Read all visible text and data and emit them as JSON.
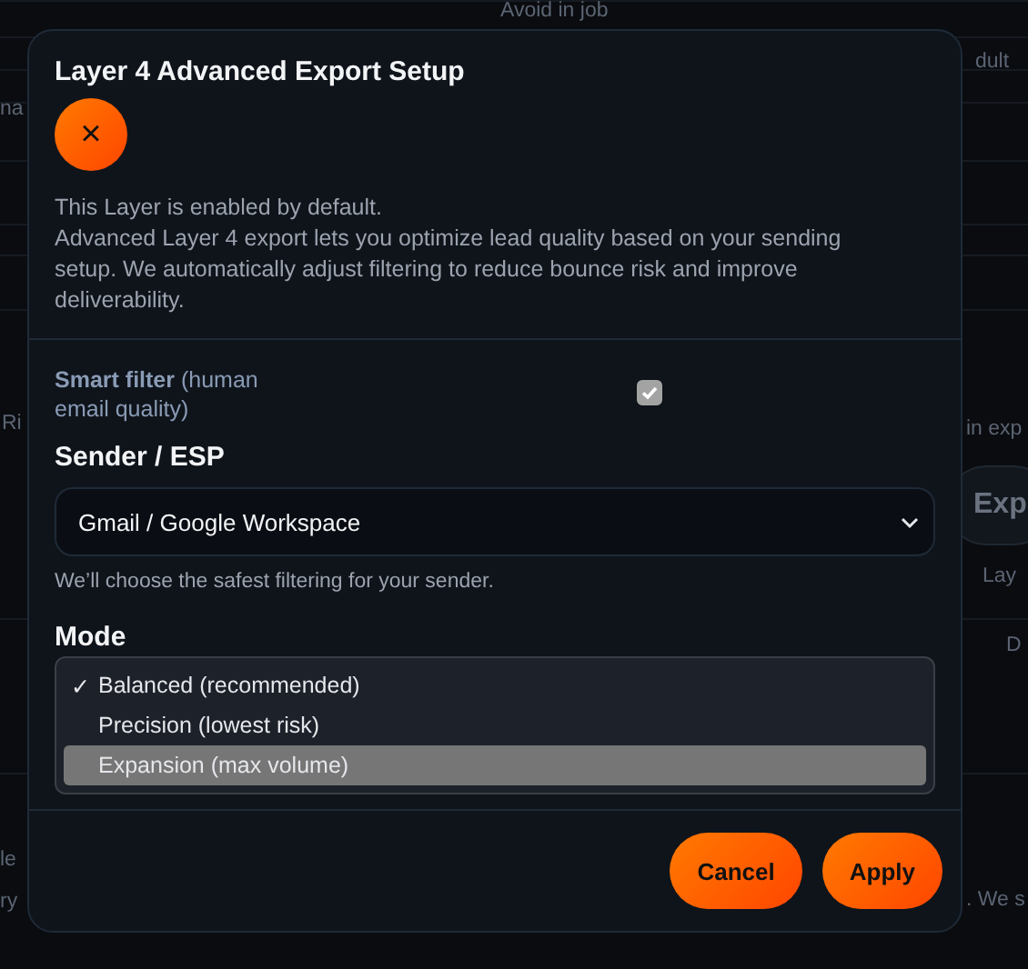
{
  "background": {
    "fragments": [
      {
        "text": "Avoid in job"
      },
      {
        "text": "dult"
      },
      {
        "text": "na"
      },
      {
        "text": "Ri"
      },
      {
        "text": "in exp"
      },
      {
        "text": "Exp",
        "kind": "button"
      },
      {
        "text": "Lay"
      },
      {
        "text": "D"
      },
      {
        "text": "le"
      },
      {
        "text": "ry"
      },
      {
        "text": ". We s"
      }
    ]
  },
  "dialog": {
    "title": "Layer 4 Advanced Export Setup",
    "close_button": {
      "label": "×"
    },
    "description": [
      "This Layer is enabled by default.",
      "Advanced Layer 4 export lets you optimize lead quality based on your sending setup. We automatically adjust filtering to reduce bounce risk and improve deliverability."
    ],
    "smart_filter": {
      "label": "**Smart filter** (human email quality)",
      "checked": true
    },
    "sender": {
      "label": "Sender / ESP",
      "value": "Gmail / Google Workspace",
      "hint": "We’ll choose the safest filtering for your sender."
    },
    "mode": {
      "label": "Mode",
      "check_mark": "✓",
      "options": [
        {
          "label": "Balanced (recommended)",
          "selected": true,
          "highlighted": false
        },
        {
          "label": "Precision (lowest risk)",
          "selected": false,
          "highlighted": false
        },
        {
          "label": "Expansion (max volume)",
          "selected": false,
          "highlighted": true
        }
      ]
    },
    "buttons": [
      {
        "label": "Cancel"
      },
      {
        "label": "Apply"
      }
    ]
  }
}
